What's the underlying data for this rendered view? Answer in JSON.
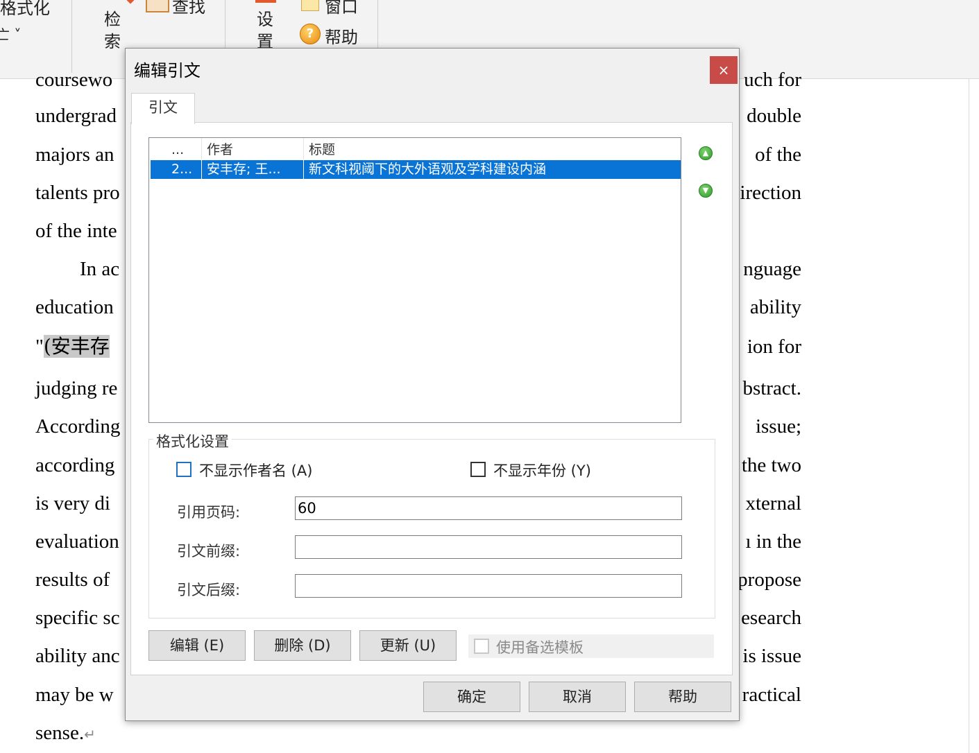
{
  "ribbon": {
    "fragment_format": "格式化",
    "fragment_dropdown": "亡 ˅",
    "search_col1": "检",
    "search_col2": "索",
    "find_label": "查找",
    "settings_col1": "设",
    "settings_col2": "置",
    "window_label": "窗口",
    "help_label": "帮助"
  },
  "document": {
    "lines": [
      {
        "left": "coursewo",
        "right": "uch for"
      },
      {
        "left": "undergrad",
        "right": "double"
      },
      {
        "left": "majors an",
        "right": "of the"
      },
      {
        "left": "talents pro",
        "right": "irection"
      },
      {
        "left": "of the inte",
        "right": ""
      },
      {
        "left": "In ac",
        "right": "nguage"
      },
      {
        "left": "education",
        "right": "ability"
      },
      {
        "left_quote": "\"",
        "left_highlight": "(安丰存 ",
        "right": "ion for"
      },
      {
        "left": "judging re",
        "right": "bstract."
      },
      {
        "left": "According",
        "right": "issue;"
      },
      {
        "left": "according",
        "right": "the two"
      },
      {
        "left": "is very di",
        "right": "xternal"
      },
      {
        "left": "evaluation",
        "right": "ı in the"
      },
      {
        "left": "results of",
        "right": "propose"
      },
      {
        "left": "specific sc",
        "right": "esearch"
      },
      {
        "left": "ability anc",
        "right": "is issue"
      },
      {
        "left": "may be w",
        "right": "ractical"
      },
      {
        "left": "sense.",
        "right": "",
        "mark": "↵"
      }
    ]
  },
  "dialog": {
    "title": "编辑引文",
    "close_glyph": "×",
    "tab_label": "引文",
    "list": {
      "headers": [
        "...",
        "作者",
        "标题"
      ],
      "rows": [
        {
          "num": "2...",
          "author": "安丰存; 王...",
          "title": "新文科视阈下的大外语观及学科建设内涵"
        }
      ]
    },
    "move_up_icon": "arrow-up-circle",
    "move_down_icon": "arrow-down-circle",
    "format_group": {
      "legend": "格式化设置",
      "hide_author": {
        "label": "不显示作者名 (A)",
        "checked": false
      },
      "hide_year": {
        "label": "不显示年份 (Y)",
        "checked": false
      },
      "page_label": "引用页码:",
      "page_value": "60",
      "prefix_label": "引文前缀:",
      "prefix_value": "",
      "suffix_label": "引文后缀:",
      "suffix_value": ""
    },
    "buttons": {
      "edit": "编辑 (E)",
      "delete": "删除 (D)",
      "update": "更新 (U)",
      "alt_template": "使用备选模板",
      "ok": "确定",
      "cancel": "取消",
      "help": "帮助"
    }
  }
}
